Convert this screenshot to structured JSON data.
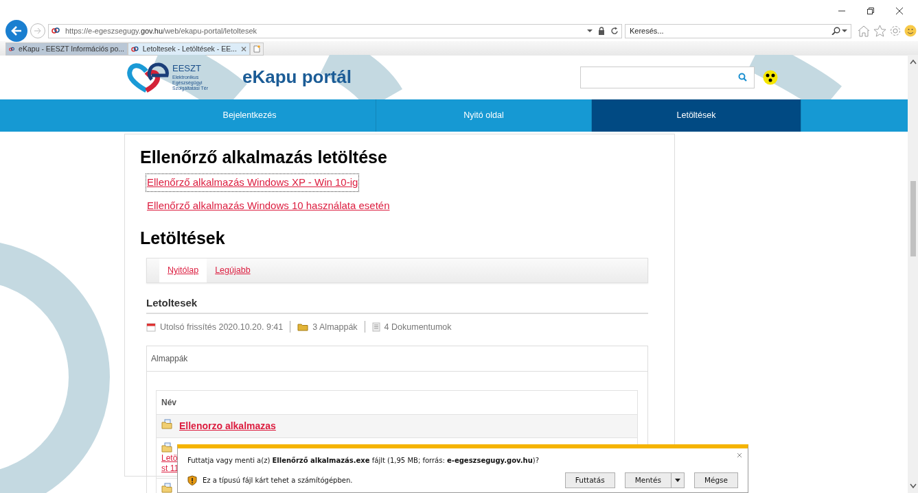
{
  "browser": {
    "url": "https://e-egeszsegugy.**gov.hu**/web/ekapu-portal/letoltesek",
    "search": {
      "placeholder": "Keresés..."
    },
    "tabs": [
      {
        "label": "eKapu - EESZT Információs po...",
        "selected": false
      },
      {
        "label": "Letoltesek - Letöltések - EE...",
        "selected": true
      }
    ]
  },
  "header": {
    "logo": {
      "name": "EESZT",
      "lines": [
        "Elektronikus",
        "Egészségügyi",
        "Szolgáltatási Tér"
      ]
    },
    "title": "eKapu portál"
  },
  "nav": [
    {
      "label": "Bejelentkezés",
      "selected": false
    },
    {
      "label": "Nyitó oldal",
      "selected": false
    },
    {
      "label": "Letöltések",
      "selected": true
    }
  ],
  "content": {
    "heading": "Ellenőrző alkalmazás letöltése",
    "links": [
      {
        "label": "Ellenőrző alkalmazás Windows XP - Win 10-ig",
        "focused": true
      },
      {
        "label": "Ellenőrző alkalmazás Windows 10 használata esetén",
        "focused": false
      }
    ],
    "downloads_heading": "Letöltések",
    "tabs": [
      {
        "label": "Nyitólap",
        "selected": true
      },
      {
        "label": "Legújabb",
        "selected": false
      }
    ],
    "folder_title": "Letoltesek",
    "meta": [
      {
        "kind": "calendar",
        "text": "Utolsó frissítés 2020.10.20. 9:41"
      },
      {
        "kind": "folder",
        "text": "3 Almappák"
      },
      {
        "kind": "document",
        "text": "4 Dokumentumok"
      }
    ],
    "panel_title": "Almappák",
    "table": {
      "columns": [
        "Név"
      ],
      "rows": [
        {
          "kind": "folder",
          "title": "Ellenorzo alkalmazas"
        },
        {
          "kind": "folder",
          "lines": [
            "Letö",
            "st 11"
          ]
        },
        {
          "kind": "folder"
        }
      ]
    }
  },
  "notification": {
    "message": "Futtatja vagy menti a(z) **Ellenőrző alkalmazás.exe** fájlt (1,95 MB; forrás: **e-egeszsegugy.gov.hu**)?",
    "warning": "Ez a típusú fájl kárt tehet a számítógépben.",
    "buttons": [
      {
        "kind": "plain",
        "label": "Futtatás"
      },
      {
        "kind": "split",
        "label": "Mentés"
      },
      {
        "kind": "plain",
        "label": "Mégse"
      }
    ]
  }
}
